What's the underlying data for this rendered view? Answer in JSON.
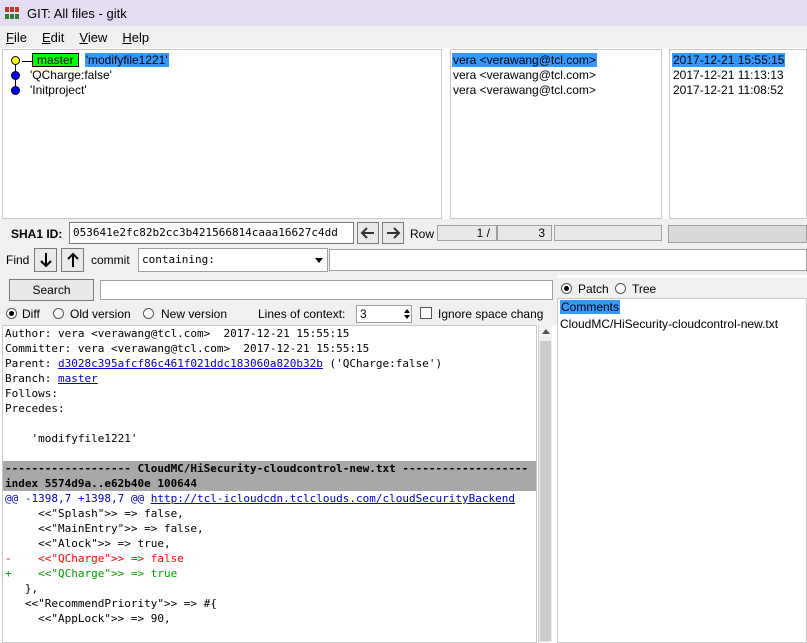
{
  "window": {
    "title": "GIT: All files - gitk"
  },
  "menu": [
    {
      "label_first": "F",
      "label_rest": "ile"
    },
    {
      "label_first": "E",
      "label_rest": "dit"
    },
    {
      "label_first": "V",
      "label_rest": "iew"
    },
    {
      "label_first": "H",
      "label_rest": "elp"
    }
  ],
  "commits": [
    {
      "branch": "master",
      "message": "'modifyfile1221'",
      "author": "vera <verawang@tcl.com>",
      "date": "2017-12-21 15:55:15"
    },
    {
      "message": "'QCharge:false'",
      "author": "vera <verawang@tcl.com>",
      "date": "2017-12-21 11:13:13"
    },
    {
      "message": "'Initproject'",
      "author": "vera <verawang@tcl.com>",
      "date": "2017-12-21 11:08:52"
    }
  ],
  "sha": {
    "label": "SHA1 ID:",
    "value": "053641e2fc82b2cc3b421566814caaa16627c4dd"
  },
  "row": {
    "label": "Row",
    "current": "1 /",
    "total": "3"
  },
  "find": {
    "label": "Find",
    "commit_label": "commit",
    "mode": "containing:"
  },
  "search": {
    "button": "Search"
  },
  "options": {
    "diff": "Diff",
    "old_version": "Old version",
    "new_version": "New version",
    "lines_of_context_label": "Lines of context:",
    "lines_of_context": "3",
    "ignore_space": "Ignore space chang"
  },
  "diff_lines": {
    "author": "Author: vera <verawang@tcl.com>  2017-12-21 15:55:15",
    "committer": "Committer: vera <verawang@tcl.com>  2017-12-21 15:55:15",
    "parent_prefix": "Parent: ",
    "parent_link": "d3028c395afcf86c461f021ddc183060a820b32b",
    "parent_suffix": " ('QCharge:false')",
    "branch_prefix": "Branch: ",
    "branch_link": "master",
    "follows": "Follows:",
    "precedes": "Precedes:",
    "message": "    'modifyfile1221'",
    "file_header": "------------------- CloudMC/HiSecurity-cloudcontrol-new.txt -------------------",
    "index": "index 5574d9a..e62b40e 100644",
    "hunk_prefix": "@@ -1398,7 +1398,7 @@ ",
    "hunk_link": "http://tcl-icloudcdn.tclclouds.com/cloudSecurityBackend",
    "ctx1": "     <<\"Splash\">> => false,",
    "ctx2": "     <<\"MainEntry\">> => false,",
    "ctx3": "     <<\"Alock\">> => true,",
    "minus1": "-    <<\"QCharge\">> => false",
    "plus1": "+    <<\"QCharge\">> => true",
    "ctx4": "   },",
    "ctx5": "   <<\"RecommendPriority\">> => #{",
    "ctx6": "     <<\"AppLock\">> => 90,"
  },
  "file_pane": {
    "patch": "Patch",
    "tree": "Tree",
    "comments": "Comments",
    "file": "CloudMC/HiSecurity-cloudcontrol-new.txt"
  },
  "colors": {
    "selection": "#3399ff",
    "branch_tag": "#00ff00",
    "added": "#00a000",
    "removed": "#ff0000"
  }
}
